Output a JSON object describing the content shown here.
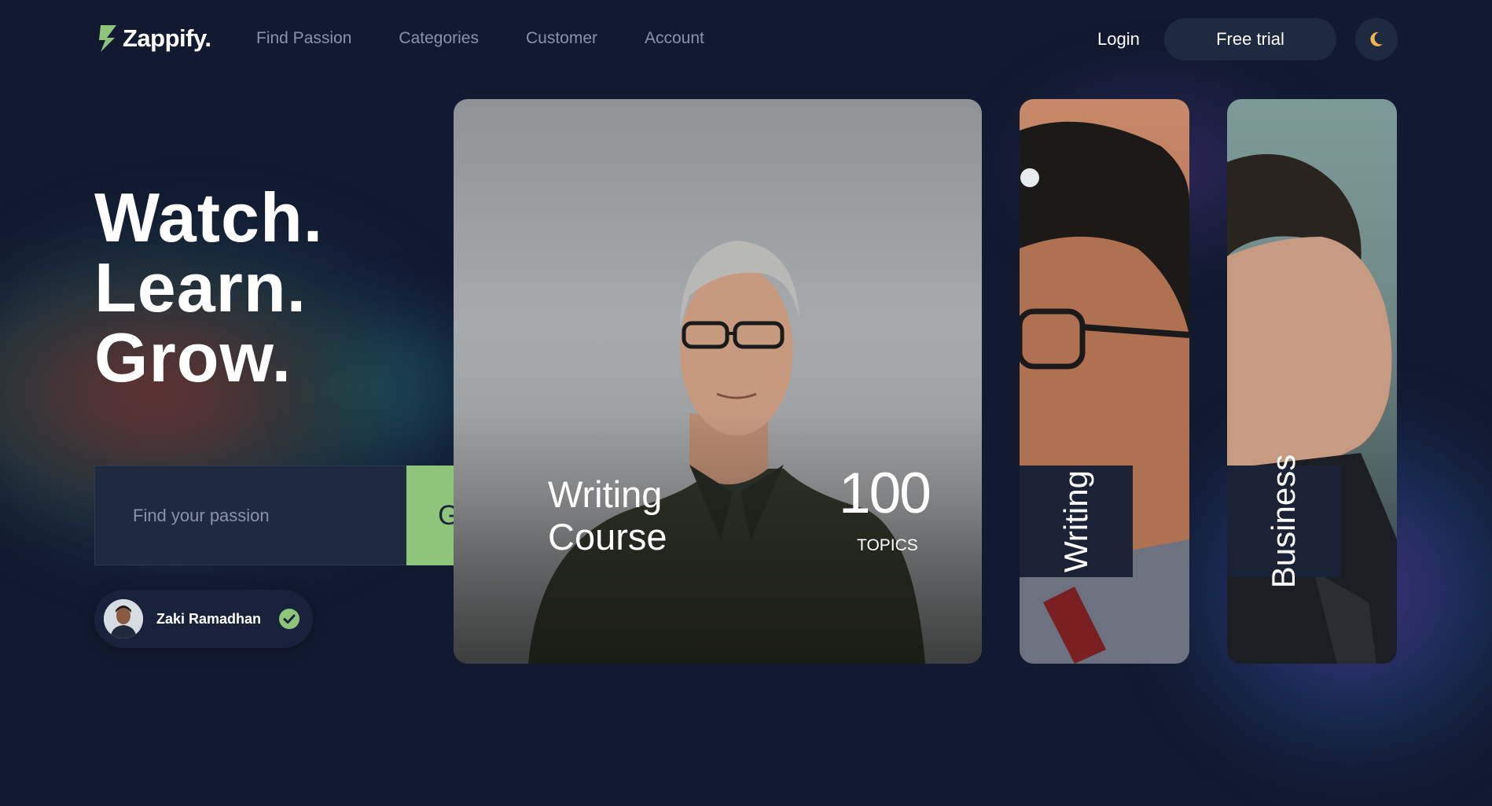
{
  "nav": {
    "logo_text": "Zappify.",
    "links": [
      "Find Passion",
      "Categories",
      "Customer",
      "Account"
    ],
    "login_label": "Login",
    "free_trial_label": "Free trial",
    "theme_icon": "moon-icon"
  },
  "hero": {
    "lines": [
      "Watch.",
      "Learn.",
      "Grow."
    ]
  },
  "search": {
    "placeholder": "Find your passion",
    "go_label": "Go"
  },
  "user": {
    "name": "Zaki Ramadhan",
    "verified_icon": "check-circle-icon"
  },
  "featured_card": {
    "title_line1": "Writing",
    "title_line2": "Course",
    "count": "100",
    "count_label": "TOPICS"
  },
  "category_cards": [
    {
      "label": "Writing"
    },
    {
      "label": "Business"
    }
  ],
  "colors": {
    "background": "#111a30",
    "accent_green": "#8fc57a",
    "surface": "#1e2a40"
  }
}
